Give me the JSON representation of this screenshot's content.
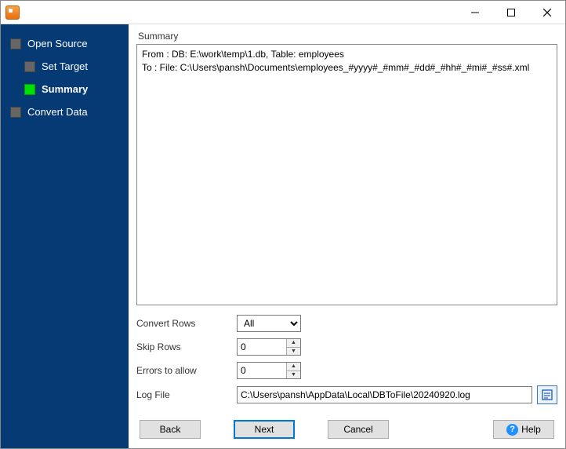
{
  "titlebar": {
    "app_icon": "app-icon"
  },
  "sidebar": {
    "items": [
      {
        "label": "Open Source",
        "indent": false,
        "current": false
      },
      {
        "label": "Set Target",
        "indent": true,
        "current": false
      },
      {
        "label": "Summary",
        "indent": true,
        "current": true
      },
      {
        "label": "Convert Data",
        "indent": false,
        "current": false
      }
    ]
  },
  "summary": {
    "heading": "Summary",
    "text": "From : DB: E:\\work\\temp\\1.db, Table: employees\nTo : File: C:\\Users\\pansh\\Documents\\employees_#yyyy#_#mm#_#dd#_#hh#_#mi#_#ss#.xml"
  },
  "form": {
    "convert_rows": {
      "label": "Convert Rows",
      "value": "All",
      "options": [
        "All"
      ]
    },
    "skip_rows": {
      "label": "Skip Rows",
      "value": "0"
    },
    "errors_allow": {
      "label": "Errors to allow",
      "value": "0"
    },
    "log_file": {
      "label": "Log File",
      "value": "C:\\Users\\pansh\\AppData\\Local\\DBToFile\\20240920.log"
    }
  },
  "buttons": {
    "back": "Back",
    "next": "Next",
    "cancel": "Cancel",
    "help": "Help"
  }
}
